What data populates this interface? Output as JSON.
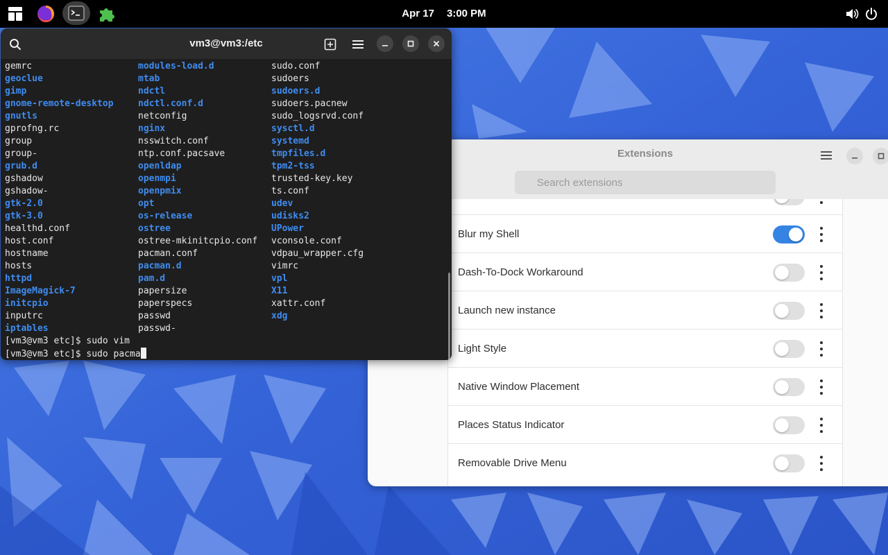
{
  "topbar": {
    "date": "Apr 17",
    "time": "3:00 PM",
    "apps": [
      {
        "icon": "activities-grid-icon"
      },
      {
        "icon": "firefox-icon"
      },
      {
        "icon": "terminal-app-icon"
      },
      {
        "icon": "extensions-puzzle-icon"
      }
    ],
    "status": [
      {
        "icon": "volume-icon"
      },
      {
        "icon": "power-icon"
      }
    ]
  },
  "terminal": {
    "title": "vm3@vm3:/etc",
    "columns": [
      [
        {
          "text": "gemrc",
          "dir": false
        },
        {
          "text": "geoclue",
          "dir": true
        },
        {
          "text": "gimp",
          "dir": true
        },
        {
          "text": "gnome-remote-desktop",
          "dir": true
        },
        {
          "text": "gnutls",
          "dir": true
        },
        {
          "text": "gprofng.rc",
          "dir": false
        },
        {
          "text": "group",
          "dir": false
        },
        {
          "text": "group-",
          "dir": false
        },
        {
          "text": "grub.d",
          "dir": true
        },
        {
          "text": "gshadow",
          "dir": false
        },
        {
          "text": "gshadow-",
          "dir": false
        },
        {
          "text": "gtk-2.0",
          "dir": true
        },
        {
          "text": "gtk-3.0",
          "dir": true
        },
        {
          "text": "healthd.conf",
          "dir": false
        },
        {
          "text": "host.conf",
          "dir": false
        },
        {
          "text": "hostname",
          "dir": false
        },
        {
          "text": "hosts",
          "dir": false
        },
        {
          "text": "httpd",
          "dir": true
        },
        {
          "text": "ImageMagick-7",
          "dir": true
        },
        {
          "text": "initcpio",
          "dir": true
        },
        {
          "text": "inputrc",
          "dir": false
        },
        {
          "text": "iptables",
          "dir": true
        }
      ],
      [
        {
          "text": "modules-load.d",
          "dir": true
        },
        {
          "text": "mtab",
          "dir": true
        },
        {
          "text": "ndctl",
          "dir": true
        },
        {
          "text": "ndctl.conf.d",
          "dir": true
        },
        {
          "text": "netconfig",
          "dir": false
        },
        {
          "text": "nginx",
          "dir": true
        },
        {
          "text": "nsswitch.conf",
          "dir": false
        },
        {
          "text": "ntp.conf.pacsave",
          "dir": false
        },
        {
          "text": "openldap",
          "dir": true
        },
        {
          "text": "openmpi",
          "dir": true
        },
        {
          "text": "openpmix",
          "dir": true
        },
        {
          "text": "opt",
          "dir": true
        },
        {
          "text": "os-release",
          "dir": true
        },
        {
          "text": "ostree",
          "dir": true
        },
        {
          "text": "ostree-mkinitcpio.conf",
          "dir": false
        },
        {
          "text": "pacman.conf",
          "dir": false
        },
        {
          "text": "pacman.d",
          "dir": true
        },
        {
          "text": "pam.d",
          "dir": true
        },
        {
          "text": "papersize",
          "dir": false
        },
        {
          "text": "paperspecs",
          "dir": false
        },
        {
          "text": "passwd",
          "dir": false
        },
        {
          "text": "passwd-",
          "dir": false
        }
      ],
      [
        {
          "text": "sudo.conf",
          "dir": false
        },
        {
          "text": "sudoers",
          "dir": false
        },
        {
          "text": "sudoers.d",
          "dir": true
        },
        {
          "text": "sudoers.pacnew",
          "dir": false
        },
        {
          "text": "sudo_logsrvd.conf",
          "dir": false
        },
        {
          "text": "sysctl.d",
          "dir": true
        },
        {
          "text": "systemd",
          "dir": true
        },
        {
          "text": "tmpfiles.d",
          "dir": true
        },
        {
          "text": "tpm2-tss",
          "dir": true
        },
        {
          "text": "trusted-key.key",
          "dir": false
        },
        {
          "text": "ts.conf",
          "dir": false
        },
        {
          "text": "udev",
          "dir": true
        },
        {
          "text": "udisks2",
          "dir": true
        },
        {
          "text": "UPower",
          "dir": true
        },
        {
          "text": "vconsole.conf",
          "dir": false
        },
        {
          "text": "vdpau_wrapper.cfg",
          "dir": false
        },
        {
          "text": "vimrc",
          "dir": false
        },
        {
          "text": "vpl",
          "dir": true
        },
        {
          "text": "X11",
          "dir": true
        },
        {
          "text": "xattr.conf",
          "dir": false
        },
        {
          "text": "xdg",
          "dir": true
        }
      ]
    ],
    "prompt_lines": [
      "[vm3@vm3 etc]$ sudo vim",
      "[vm3@vm3 etc]$ sudo pacma"
    ]
  },
  "extensions": {
    "title": "Extensions",
    "search_placeholder": "Search extensions",
    "items": [
      {
        "name": "",
        "enabled": false
      },
      {
        "name": "Blur my Shell",
        "enabled": true
      },
      {
        "name": "Dash-To-Dock Workaround",
        "enabled": false
      },
      {
        "name": "Launch new instance",
        "enabled": false
      },
      {
        "name": "Light Style",
        "enabled": false
      },
      {
        "name": "Native Window Placement",
        "enabled": false
      },
      {
        "name": "Places Status Indicator",
        "enabled": false
      },
      {
        "name": "Removable Drive Menu",
        "enabled": false
      }
    ]
  },
  "colors": {
    "accent": "#3584e4",
    "terminal_dir": "#3f8cf0",
    "terminal_bg": "#1e1e1e"
  }
}
